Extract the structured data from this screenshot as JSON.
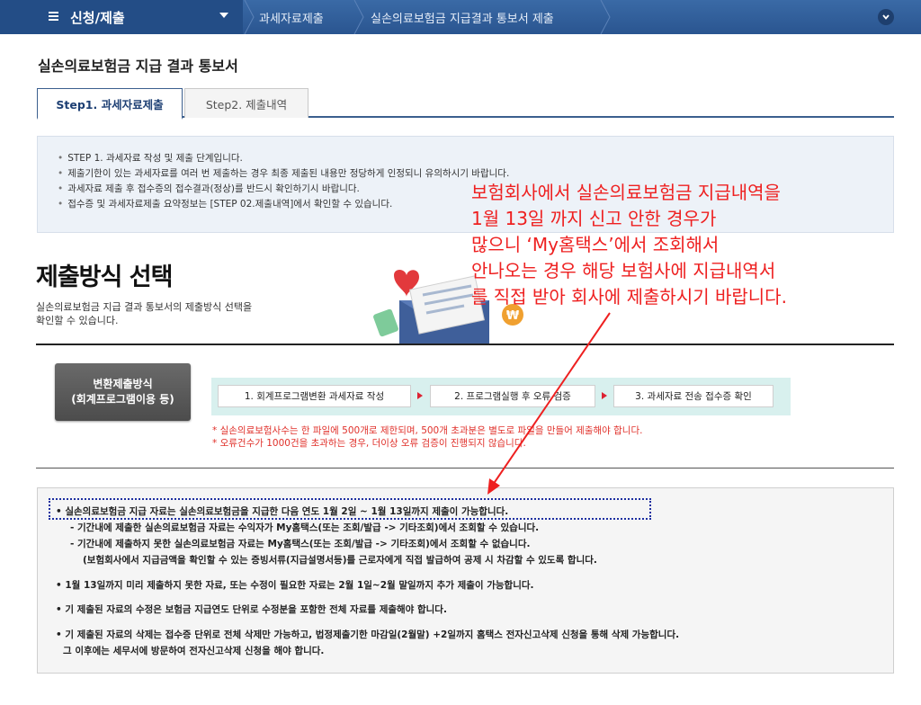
{
  "topbar": {
    "menu_title": "신청/제출",
    "crumbs": [
      "과세자료제출",
      "실손의료보험금 지급결과 통보서 제출"
    ]
  },
  "page_title": "실손의료보험금 지급 결과 통보서",
  "tabs": [
    "Step1. 과세자료제출",
    "Step2. 제출내역"
  ],
  "info": [
    "STEP 1. 과세자료 작성 및 제출 단계입니다.",
    "제출기한이 있는 과세자료를 여러 번 제출하는 경우 최종 제출된 내용만 정당하게 인정되니 유의하시기 바랍니다.",
    "과세자료 제출 후 접수증의 접수결과(정상)를 반드시 확인하기시 바랍니다.",
    "접수증 및 과세자료제출 요약정보는 [STEP 02.제출내역]에서 확인할 수 있습니다."
  ],
  "section": {
    "title": "제출방식 선택",
    "desc_1": "실손의료보험금 지급 결과 통보서의 제출방식 선택을",
    "desc_2": "확인할 수 있습니다."
  },
  "method": {
    "line1": "변환제출방식",
    "line2": "(회계프로그램이용 등)"
  },
  "steps": [
    "1. 회계프로그램변환 과세자료 작성",
    "2. 프로그램실행 후 오류 검증",
    "3. 과세자료 전송 접수증 확인"
  ],
  "red_notes": [
    "* 실손의료보험사수는 한 파일에 500개로 제한되며, 500개 초과분은 별도로 파일을 만들어 제출해야 합니다.",
    "* 오류건수가 1000건을 초과하는 경우, 더이상 오류 검증이 진행되지 않습니다."
  ],
  "notice": {
    "l1": "• 실손의료보험금 지급 자료는 실손의료보험금을 지급한 다음 연도 1월 2일 ~ 1월 13일까지 제출이 가능합니다.",
    "l2": "- 기간내에 제출한 실손의료보험금 자료는 수익자가 My홈택스(또는 조회/발급 -> 기타조회)에서 조회할 수 있습니다.",
    "l3": "- 기간내에 제출하지 못한 실손의료보험금 자료는 My홈택스(또는 조회/발급 -> 기타조회)에서 조회할 수 없습니다.",
    "l4": "(보험회사에서 지급금액을 확인할 수 있는 증빙서류(지급설명서등)를 근로자에게 직접 발급하여 공제 시 차감할 수 있도록 합니다.",
    "l5": "• 1월 13일까지 미리 제출하지 못한 자료, 또는 수정이 필요한 자료는 2월 1일~2월 말일까지 추가 제출이 가능합니다.",
    "l6": "• 기 제출된 자료의 수정은 보험금 지급연도 단위로 수정분을 포함한 전체 자료를 제출해야 합니다.",
    "l7": "• 기 제출된 자료의 삭제는 접수증 단위로 전체 삭제만 가능하고, 법정제출기한 마감일(2월말) +2일까지 홈택스 전자신고삭제 신청을 통해 삭제 가능합니다.",
    "l8": "그 이후에는 세무서에 방문하여 전자신고삭제 신청을 해야 합니다."
  },
  "overlay": {
    "l1": "보험회사에서 실손의료보험금 지급내역을",
    "l2": "1월 13일 까지 신고 안한 경우가",
    "l3": "많으니 ‘My홈택스’에서 조회해서",
    "l4": "안나오는 경우 해당 보험사에 지급내역서",
    "l5": "를 직접 받아 회사에 제출하시기 바랍니다."
  },
  "colors": {
    "topbar": "#2a5590",
    "accent_red": "#ee2020",
    "highlight_border": "#1d2fa0"
  }
}
